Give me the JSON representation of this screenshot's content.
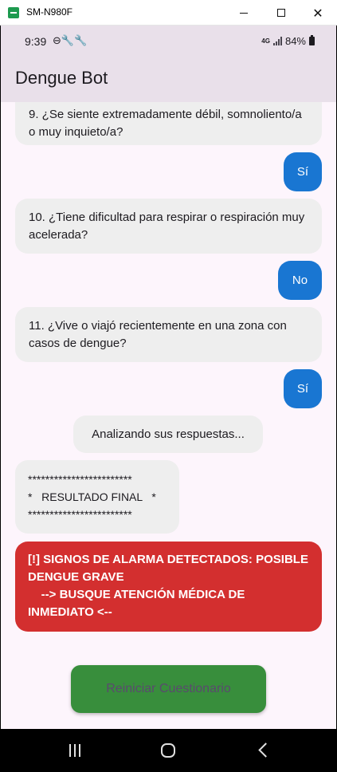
{
  "window": {
    "title": "SM-N980F",
    "minimize": "",
    "maximize": "",
    "close": "✕"
  },
  "status_bar": {
    "time": "9:39",
    "left_icons": "⊖🔧🔧",
    "network": "4G",
    "battery_percent": "84%"
  },
  "app_bar": {
    "title": "Dengue Bot"
  },
  "messages": [
    {
      "sender": "bot",
      "text": "9. ¿Se siente extremadamente débil, somnoliento/a o muy inquieto/a?"
    },
    {
      "sender": "user",
      "text": "Sí"
    },
    {
      "sender": "bot",
      "text": "10. ¿Tiene dificultad para respirar o respiración muy acelerada?"
    },
    {
      "sender": "user",
      "text": "No"
    },
    {
      "sender": "bot",
      "text": "11. ¿Vive o viajó recientemente en una zona con casos de dengue?"
    },
    {
      "sender": "user",
      "text": "Sí"
    },
    {
      "sender": "bot",
      "text": "Analizando sus respuestas..."
    },
    {
      "sender": "bot",
      "text": "************************\n*   RESULTADO FINAL   *\n************************"
    }
  ],
  "alarm": {
    "text": "[!] SIGNOS DE ALARMA DETECTADOS: POSIBLE DENGUE GRAVE\n    --> BUSQUE ATENCIÓN MÉDICA DE INMEDIATO <--",
    "color": "#d32f2f"
  },
  "restart_button": {
    "label": "Reiniciar Cuestionario",
    "color": "#388e3c"
  },
  "colors": {
    "user_bubble": "#1976d2",
    "bot_bubble": "#eeeeee",
    "app_bar": "#e9e0ea",
    "background": "#fdf5fc"
  }
}
